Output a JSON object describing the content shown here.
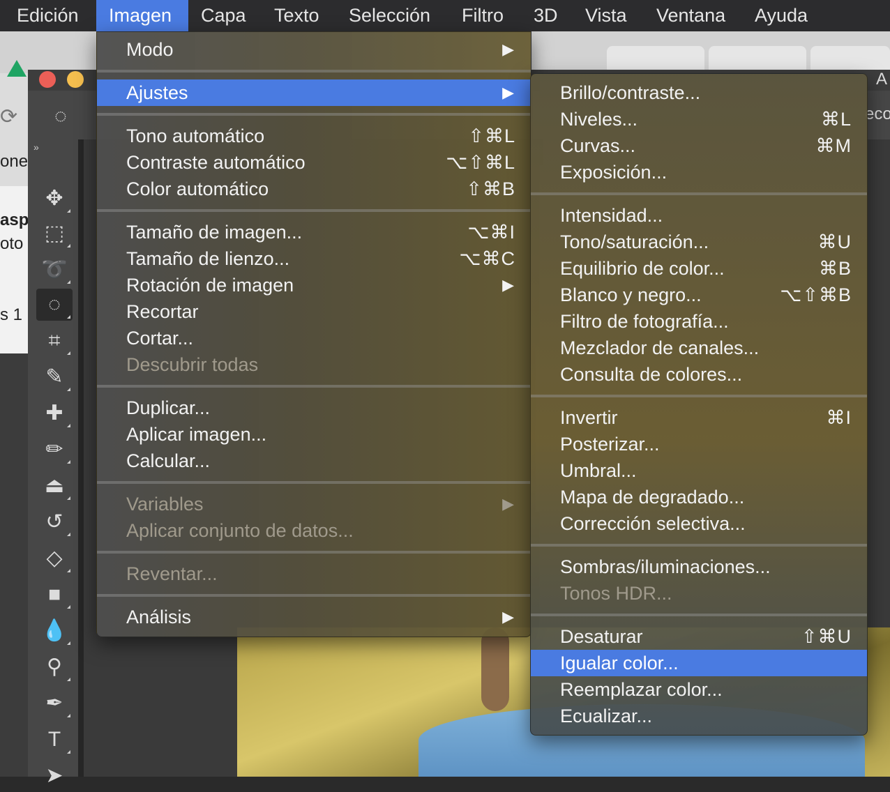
{
  "menubar": {
    "items": [
      {
        "label": "Edición"
      },
      {
        "label": "Imagen"
      },
      {
        "label": "Capa"
      },
      {
        "label": "Texto"
      },
      {
        "label": "Selección"
      },
      {
        "label": "Filtro"
      },
      {
        "label": "3D"
      },
      {
        "label": "Vista"
      },
      {
        "label": "Ventana"
      },
      {
        "label": "Ayuda"
      }
    ],
    "active": "Imagen"
  },
  "imagen_menu": {
    "modo": {
      "label": "Modo",
      "arrow": "▶"
    },
    "ajustes": {
      "label": "Ajustes",
      "arrow": "▶"
    },
    "tono_auto": {
      "label": "Tono automático",
      "shortcut": "⇧⌘L"
    },
    "contraste_auto": {
      "label": "Contraste automático",
      "shortcut": "⌥⇧⌘L"
    },
    "color_auto": {
      "label": "Color automático",
      "shortcut": "⇧⌘B"
    },
    "tamano_imagen": {
      "label": "Tamaño de imagen...",
      "shortcut": "⌥⌘I"
    },
    "tamano_lienzo": {
      "label": "Tamaño de lienzo...",
      "shortcut": "⌥⌘C"
    },
    "rotacion": {
      "label": "Rotación de imagen",
      "arrow": "▶"
    },
    "recortar": {
      "label": "Recortar"
    },
    "cortar": {
      "label": "Cortar..."
    },
    "descubrir": {
      "label": "Descubrir todas"
    },
    "duplicar": {
      "label": "Duplicar..."
    },
    "aplicar_imagen": {
      "label": "Aplicar imagen..."
    },
    "calcular": {
      "label": "Calcular..."
    },
    "variables": {
      "label": "Variables",
      "arrow": "▶"
    },
    "aplicar_conjunto": {
      "label": "Aplicar conjunto de datos..."
    },
    "reventar": {
      "label": "Reventar..."
    },
    "analisis": {
      "label": "Análisis",
      "arrow": "▶"
    }
  },
  "ajustes_menu": {
    "brillo": {
      "label": "Brillo/contraste..."
    },
    "niveles": {
      "label": "Niveles...",
      "shortcut": "⌘L"
    },
    "curvas": {
      "label": "Curvas...",
      "shortcut": "⌘M"
    },
    "exposicion": {
      "label": "Exposición..."
    },
    "intensidad": {
      "label": "Intensidad..."
    },
    "tono_sat": {
      "label": "Tono/saturación...",
      "shortcut": "⌘U"
    },
    "equilibrio": {
      "label": "Equilibrio de color...",
      "shortcut": "⌘B"
    },
    "blanco_negro": {
      "label": "Blanco y negro...",
      "shortcut": "⌥⇧⌘B"
    },
    "filtro_foto": {
      "label": "Filtro de fotografía..."
    },
    "mezclador": {
      "label": "Mezclador de canales..."
    },
    "consulta": {
      "label": "Consulta de colores..."
    },
    "invertir": {
      "label": "Invertir",
      "shortcut": "⌘I"
    },
    "posterizar": {
      "label": "Posterizar..."
    },
    "umbral": {
      "label": "Umbral..."
    },
    "mapa": {
      "label": "Mapa de degradado..."
    },
    "correccion": {
      "label": "Corrección selectiva..."
    },
    "sombras": {
      "label": "Sombras/iluminaciones..."
    },
    "hdr": {
      "label": "Tonos HDR..."
    },
    "desaturar": {
      "label": "Desaturar",
      "shortcut": "⇧⌘U"
    },
    "igualar": {
      "label": "Igualar color..."
    },
    "reemplazar": {
      "label": "Reemplazar color..."
    },
    "ecualizar": {
      "label": "Ecualizar..."
    }
  },
  "background": {
    "side_texts": [
      "one",
      "asp",
      "oto",
      "s 1"
    ],
    "right_label": "A",
    "right_label2": "eco",
    "collapse_label": "»"
  },
  "colors": {
    "accent": "#4a7be1",
    "menubar_bg": "#2c2c2e",
    "traffic_close": "#ec5f57",
    "traffic_min": "#f5bf4f"
  },
  "toolbar_icons": [
    "move-icon",
    "marquee-icon",
    "lasso-icon",
    "quick-selection-icon",
    "crop-icon",
    "eyedropper-icon",
    "healing-brush-icon",
    "brush-icon",
    "clone-stamp-icon",
    "history-brush-icon",
    "eraser-icon",
    "gradient-icon",
    "blur-icon",
    "dodge-icon",
    "pen-icon",
    "type-icon",
    "path-selection-icon"
  ]
}
